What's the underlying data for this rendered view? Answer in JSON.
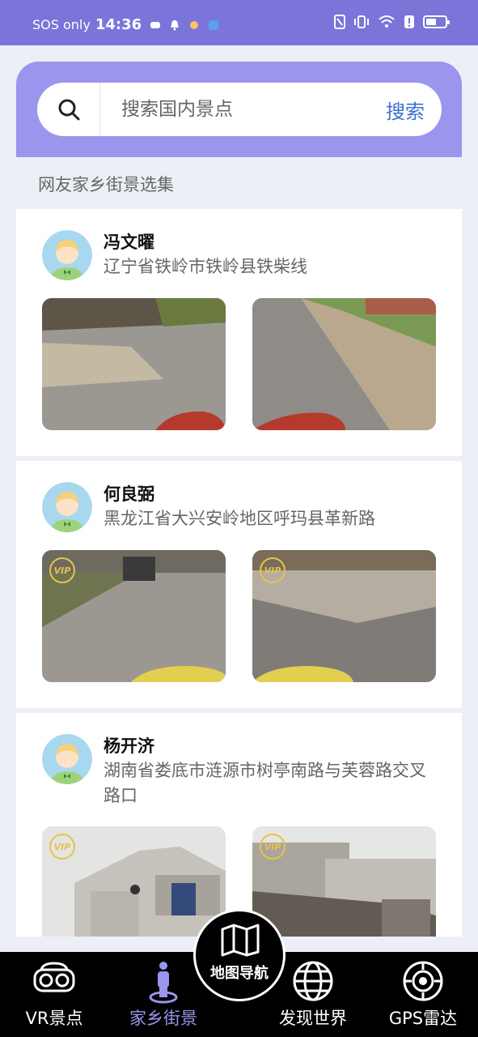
{
  "status": {
    "sos": "SOS only",
    "time": "14:36",
    "battery_level": 0.55
  },
  "search": {
    "placeholder": "搜索国内景点",
    "button_label": "搜索"
  },
  "section_title": "网友家乡街景选集",
  "cards": [
    {
      "name": "冯文曜",
      "address": "辽宁省铁岭市铁岭县铁柴线",
      "vip": false
    },
    {
      "name": "何良弼",
      "address": "黑龙江省大兴安岭地区呼玛县革新路",
      "vip": true
    },
    {
      "name": "杨开济",
      "address": "湖南省娄底市涟源市树亭南路与芙蓉路交叉路口",
      "vip": true
    }
  ],
  "vip_label": "VIP",
  "tabs": [
    {
      "label": "VR景点",
      "icon": "vr-headset-icon"
    },
    {
      "label": "家乡街景",
      "icon": "person-pin-icon",
      "active": true
    },
    {
      "label": "发现世界",
      "icon": "globe-icon"
    },
    {
      "label": "GPS雷达",
      "icon": "radar-icon"
    }
  ],
  "center_button": {
    "label": "地图导航",
    "icon": "map-icon"
  },
  "colors": {
    "status_bar": "#7b74d9",
    "search_panel": "#9b95ee",
    "search_button": "#3f6fd0",
    "active_tab": "#9b95ee",
    "vip": "#e7c34d"
  }
}
